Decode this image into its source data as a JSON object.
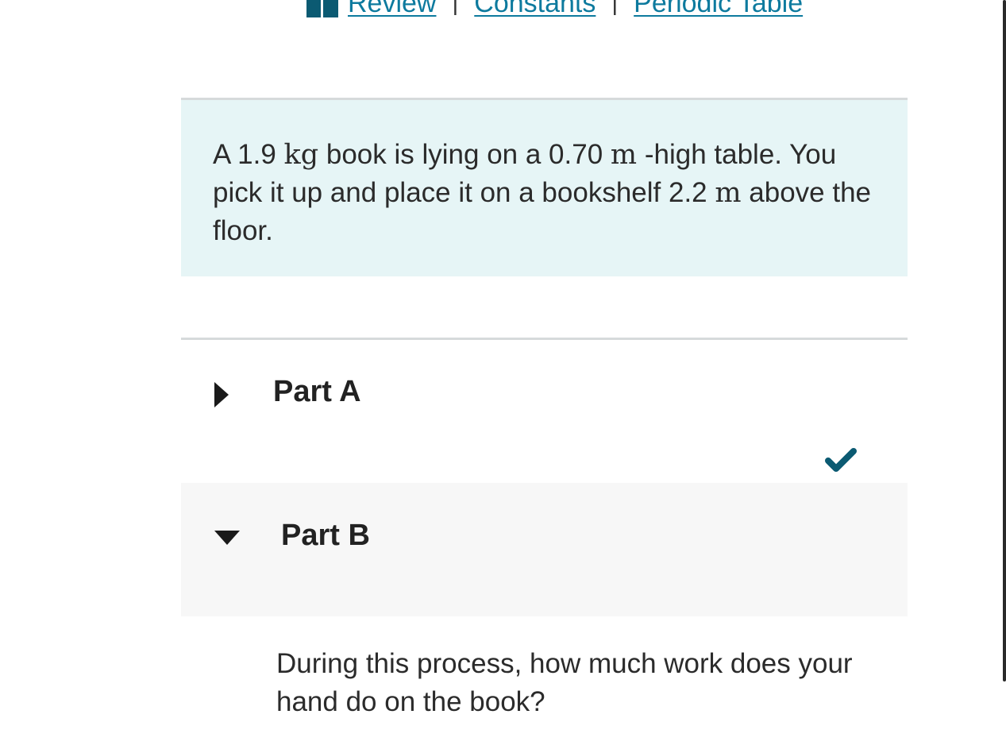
{
  "resources": {
    "review": "Review",
    "constants": "Constants",
    "periodic_table": "Periodic Table",
    "separator": "|",
    "icon": "book-icon"
  },
  "intro": {
    "t1": "A 1.9 ",
    "u1": "kg",
    "t2": " book is lying on a 0.70 ",
    "u2": "m",
    "t3": " -high table. You pick it up and place it on a bookshelf 2.2 ",
    "u3": "m",
    "t4": " above the floor."
  },
  "parts": {
    "a": {
      "title": "Part A",
      "completed": true,
      "expanded": false
    },
    "b": {
      "title": "Part B",
      "expanded": true
    }
  },
  "question": "During this process, how much work does your hand do on the book?",
  "colors": {
    "link": "#0d7a9e",
    "intro_bg": "#e6f5f6",
    "check": "#0b5a72",
    "part_b_bg": "#f7f7f7"
  }
}
